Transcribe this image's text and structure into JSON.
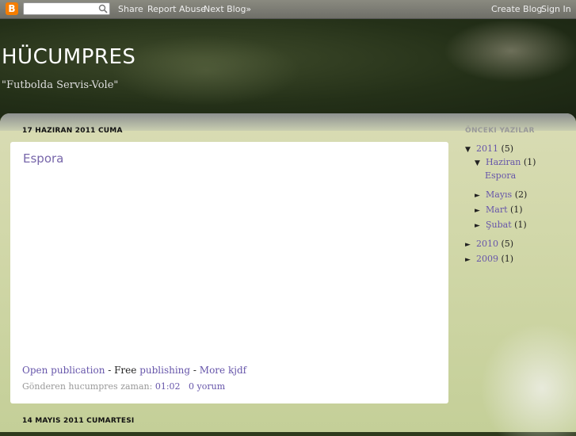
{
  "navbar": {
    "logo_text": "B",
    "search_placeholder": "",
    "share": "Share",
    "report_abuse": "Report Abuse",
    "next_blog": "Next Blog»",
    "create_blog": "Create Blog",
    "sign_in": "Sign In"
  },
  "header": {
    "title": "HÜCUMPRES",
    "description": "\"Futbolda Servis-Vole\""
  },
  "posts": [
    {
      "date": "17 HAZIRAN 2011 CUMA",
      "title": "Espora",
      "open_publication": "Open publication",
      "sep1": " - Free ",
      "publishing": "publishing",
      "sep2": " - ",
      "more": "More kjdf",
      "footer_prefix": "Gönderen hucumpres zaman: ",
      "time": "01:02",
      "comments": "0 yorum"
    },
    {
      "date": "14 MAYIS 2011 CUMARTESI"
    }
  ],
  "sidebar": {
    "heading": "ÖNCEKI YAZILAR",
    "archive": [
      {
        "toggle": "▼",
        "label": "2011",
        "count": "(5)"
      },
      {
        "toggle": "▼",
        "label": "Haziran",
        "count": "(1)"
      },
      {
        "toggle": "",
        "label": "Espora",
        "count": ""
      },
      {
        "toggle": "►",
        "label": "Mayıs",
        "count": "(2)"
      },
      {
        "toggle": "►",
        "label": "Mart",
        "count": "(1)"
      },
      {
        "toggle": "►",
        "label": "Şubat",
        "count": "(1)"
      },
      {
        "toggle": "►",
        "label": "2010",
        "count": "(5)"
      },
      {
        "toggle": "►",
        "label": "2009",
        "count": "(1)"
      }
    ]
  },
  "colors": {
    "link": "#6655aa",
    "navbar": "#7a7a72",
    "content_bg": "#d4d8aa"
  }
}
